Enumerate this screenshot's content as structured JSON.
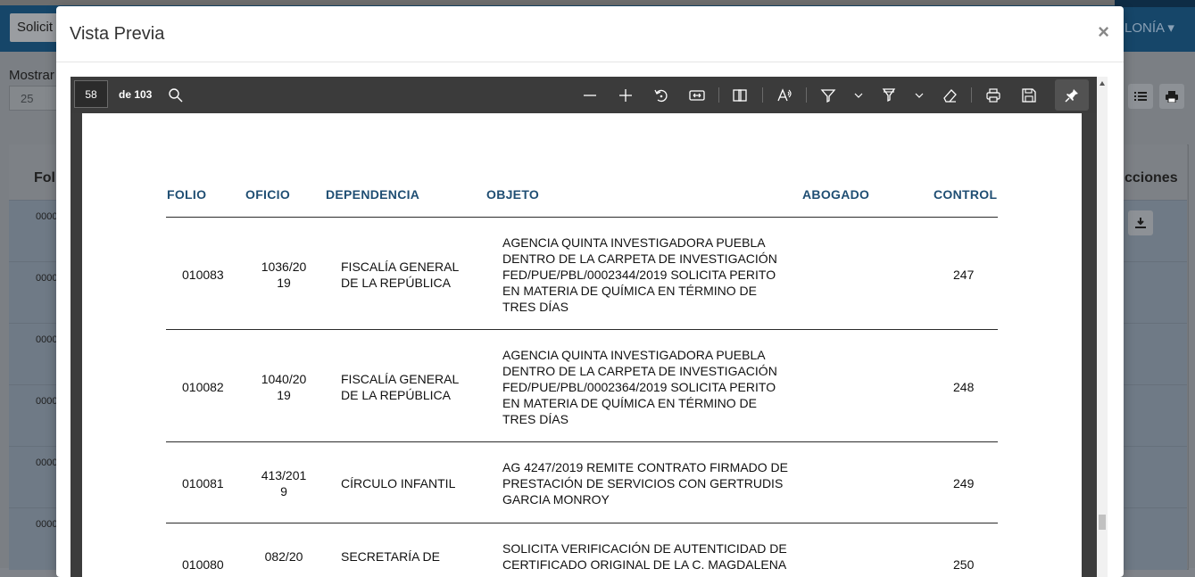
{
  "background": {
    "top_select_label": "Solicit",
    "user_menu_label": "LONÍA",
    "show_label": "Mostrar",
    "page_size_value": "25",
    "column_folio": "Fol",
    "column_actions": "cciones",
    "row_prefixes": [
      "0000",
      "0000",
      "0000",
      "0000",
      "0000",
      "0000"
    ]
  },
  "modal": {
    "title": "Vista Previa",
    "close_label": "×"
  },
  "viewer": {
    "current_page": "58",
    "total_pages": "de 103",
    "tools": [
      "search-icon",
      "zoom-out-icon",
      "zoom-in-icon",
      "rotate-icon",
      "fit-width-icon",
      "two-page-icon",
      "read-aloud-icon",
      "draw-icon",
      "highlight-icon",
      "erase-icon",
      "print-icon",
      "save-icon",
      "pin-icon"
    ]
  },
  "table": {
    "headers": {
      "folio": "FOLIO",
      "oficio": "OFICIO",
      "dependencia": "DEPENDENCIA",
      "objeto": "OBJETO",
      "abogado": "ABOGADO",
      "control": "CONTROL"
    },
    "rows": [
      {
        "folio": "010083",
        "oficio": "1036/2019",
        "dependencia": "FISCALÍA GENERAL DE LA REPÚBLICA",
        "objeto": "AGENCIA QUINTA INVESTIGADORA PUEBLA DENTRO DE LA CARPETA DE INVESTIGACIÓN FED/PUE/PBL/0002344/2019 SOLICITA PERITO EN MATERIA DE QUÍMICA EN TÉRMINO DE TRES DÍAS",
        "abogado": "",
        "control": "247"
      },
      {
        "folio": "010082",
        "oficio": "1040/2019",
        "dependencia": "FISCALÍA GENERAL DE LA REPÚBLICA",
        "objeto": "AGENCIA QUINTA INVESTIGADORA PUEBLA DENTRO DE LA CARPETA DE INVESTIGACIÓN FED/PUE/PBL/0002364/2019 SOLICITA PERITO EN MATERIA DE QUÍMICA EN TÉRMINO DE TRES DÍAS",
        "abogado": "",
        "control": "248"
      },
      {
        "folio": "010081",
        "oficio": "413/2019",
        "dependencia": "CÍRCULO INFANTIL",
        "objeto": "AG 4247/2019 REMITE CONTRATO FIRMADO DE PRESTACIÓN DE SERVICIOS CON GERTRUDIS GARCIA MONROY",
        "abogado": "",
        "control": "249"
      },
      {
        "folio": "010080",
        "oficio": "082/20",
        "dependencia": "SECRETARÍA DE",
        "objeto": "SOLICITA VERIFICACIÓN DE AUTENTICIDAD DE CERTIFICADO ORIGINAL DE LA C. MAGDALENA",
        "abogado": "",
        "control": "250"
      }
    ]
  }
}
